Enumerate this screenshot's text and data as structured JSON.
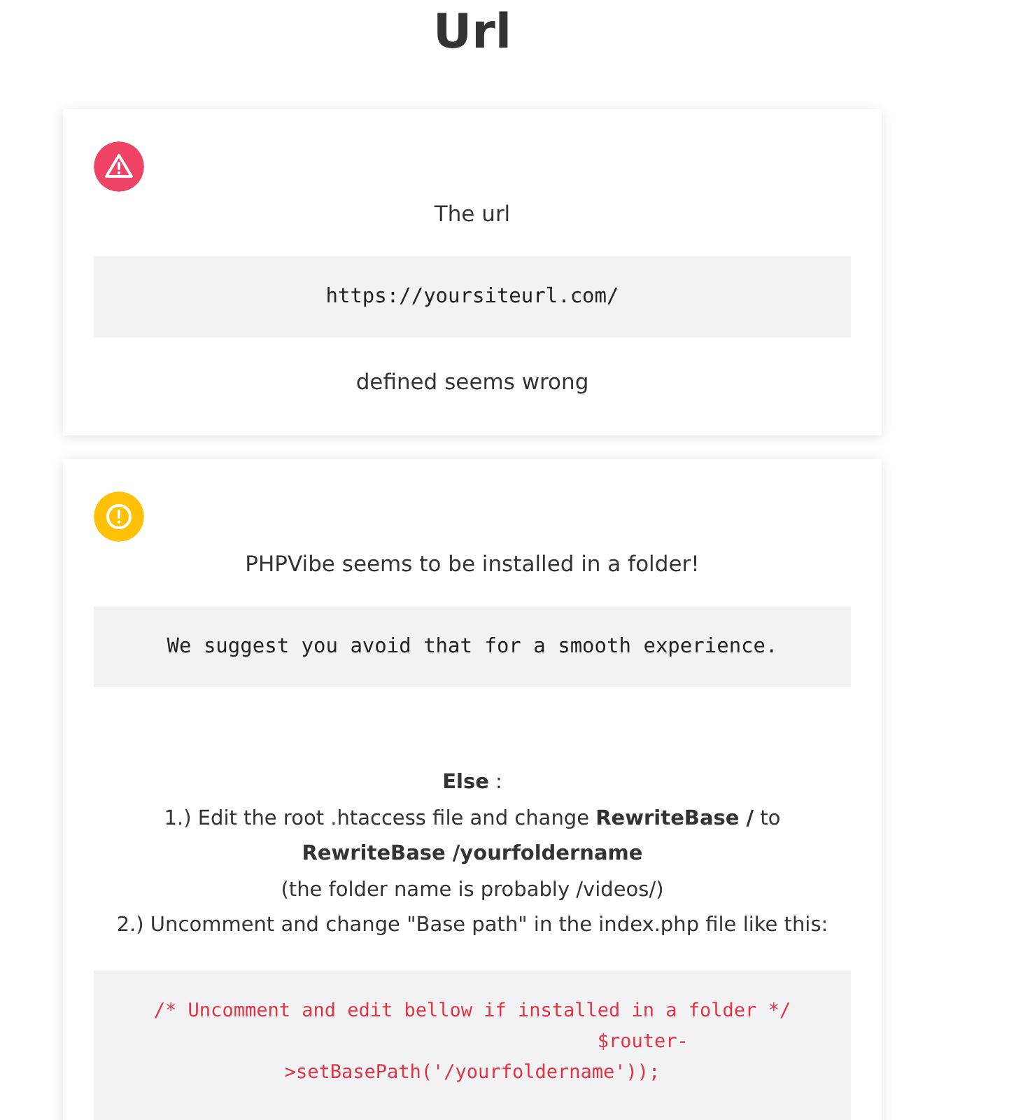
{
  "title": "Url",
  "cards": [
    {
      "kind": "error",
      "items": [
        {
          "kind": "text",
          "text": "The url"
        },
        {
          "kind": "code",
          "text": "https://yoursiteurl.com/"
        },
        {
          "kind": "text",
          "text": "defined seems wrong"
        }
      ]
    },
    {
      "kind": "warning",
      "items": [
        {
          "kind": "text",
          "text": "PHPVibe seems to be installed in a folder!"
        },
        {
          "kind": "code",
          "text": "We suggest you avoid that for a smooth experience."
        },
        {
          "kind": "paragraph",
          "text": "**Else** :\n1.) Edit the root .htaccess file and change **RewriteBase /** to\n**RewriteBase /yourfoldername**\n(the folder name is probably /videos/)\n2.) Uncomment and change \"Base path\" in the index.php file like this:"
        },
        {
          "kind": "snippet",
          "text": "/* Uncomment and edit bellow if installed in a folder */\n                              $router-\n>setBasePath('/yourfoldername'));"
        }
      ]
    }
  ]
}
